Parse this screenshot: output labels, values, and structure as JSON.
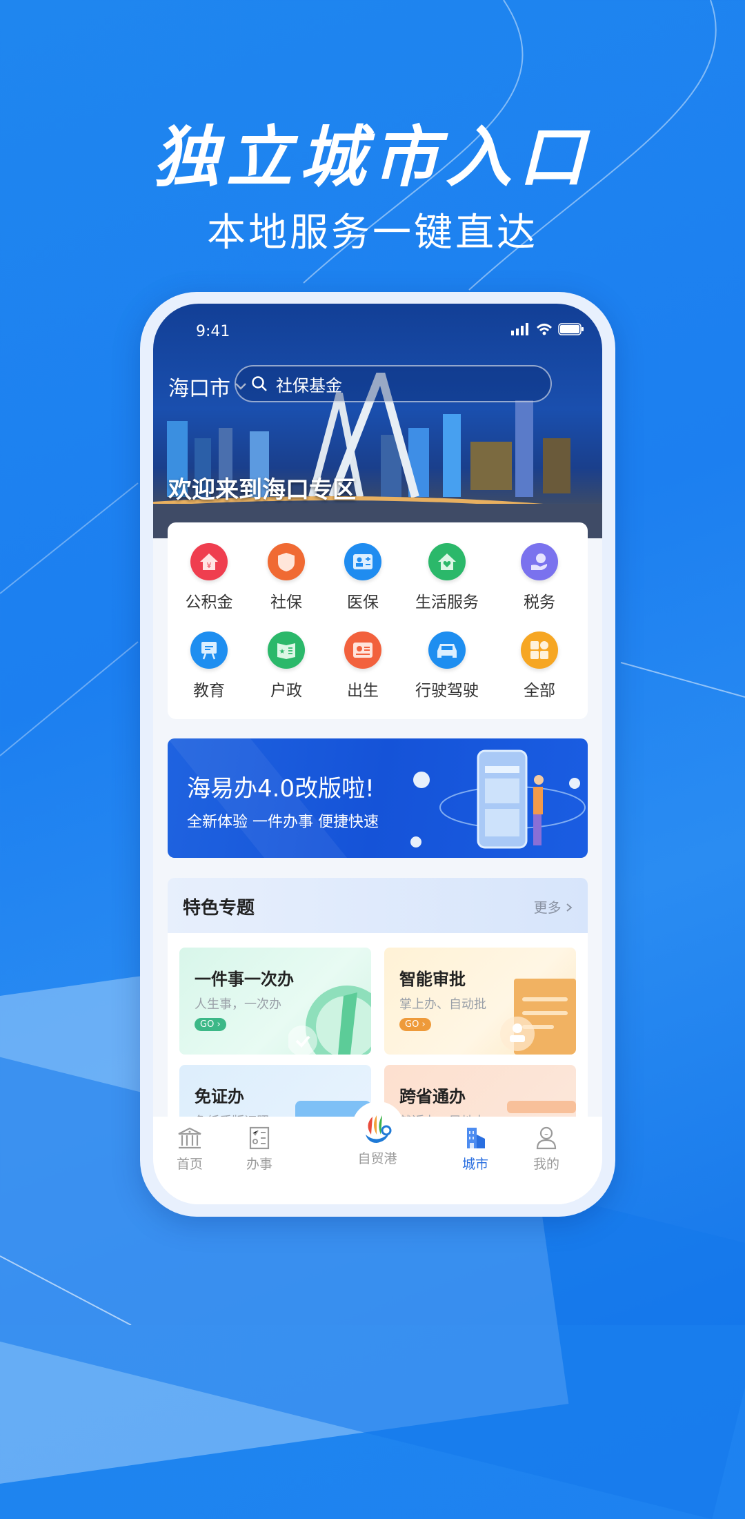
{
  "promo": {
    "headline": "独立城市入口",
    "subline": "本地服务一键直达"
  },
  "phone": {
    "status_bar": {
      "time": "9:41",
      "icons": [
        "signal-icon",
        "wifi-icon",
        "battery-icon"
      ]
    },
    "header": {
      "city": "海口市",
      "search_placeholder": "社保基金",
      "welcome": "欢迎来到海口专区"
    },
    "services": [
      {
        "label": "公积金",
        "icon": "housing-fund-icon",
        "color": "#ef3e4f"
      },
      {
        "label": "社保",
        "icon": "social-security-icon",
        "color": "#f06a33"
      },
      {
        "label": "医保",
        "icon": "medical-insurance-icon",
        "color": "#1f8cf0"
      },
      {
        "label": "生活服务",
        "icon": "life-service-icon",
        "color": "#2bb86a"
      },
      {
        "label": "税务",
        "icon": "tax-icon",
        "color": "#7a72ee"
      },
      {
        "label": "教育",
        "icon": "education-icon",
        "color": "#1e8ef0"
      },
      {
        "label": "户政",
        "icon": "household-icon",
        "color": "#2bb86a"
      },
      {
        "label": "出生",
        "icon": "birth-icon",
        "color": "#f2613d"
      },
      {
        "label": "行驶驾驶",
        "icon": "car-icon",
        "color": "#1e8ef0"
      },
      {
        "label": "全部",
        "icon": "all-apps-icon",
        "color": "#f6a623"
      }
    ],
    "banner": {
      "title": "海易办4.0改版啦!",
      "subtitle": "全新体验 一件办事 便捷快速"
    },
    "featured": {
      "title": "特色专题",
      "more": "更多",
      "cards": [
        {
          "title": "一件事一次办",
          "subtitle": "人生事，一次办",
          "go": "GO",
          "color": "#3cb887"
        },
        {
          "title": "智能审批",
          "subtitle": "掌上办、自动批",
          "go": "GO",
          "color": "#ee9a3a"
        },
        {
          "title": "免证办",
          "subtitle": "免纸质版证照"
        },
        {
          "title": "跨省通办",
          "subtitle": "就近办、异地办"
        }
      ]
    },
    "tabbar": {
      "active": "城市",
      "tabs": [
        {
          "label": "首页",
          "icon": "home-icon"
        },
        {
          "label": "办事",
          "icon": "tasks-icon"
        },
        {
          "label": "自贸港",
          "icon": "free-trade-port-logo-icon"
        },
        {
          "label": "城市",
          "icon": "city-icon"
        },
        {
          "label": "我的",
          "icon": "profile-icon"
        }
      ]
    }
  }
}
